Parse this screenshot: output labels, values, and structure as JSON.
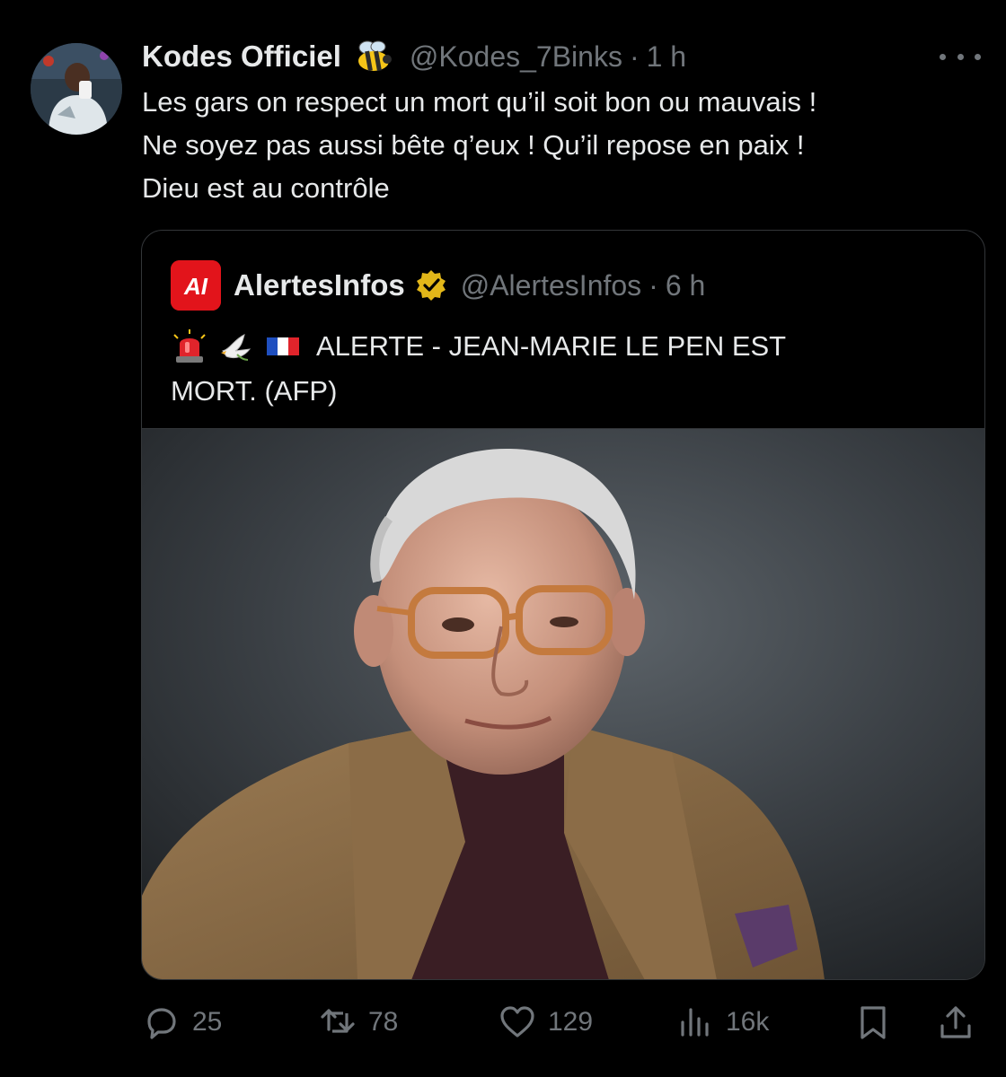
{
  "tweet": {
    "author_name": "Kodes Officiel",
    "author_handle": "@Kodes_7Binks",
    "separator": "·",
    "time": "1 h",
    "name_emoji": "bee",
    "text_lines": [
      "Les gars on respect un mort qu’il soit bon ou mauvais !",
      "Ne soyez pas aussi bête q’eux ! Qu’il repose en paix !",
      "Dieu est au contrôle"
    ]
  },
  "quote": {
    "author_name": "AlertesInfos",
    "author_handle": "@AlertesInfos",
    "separator": "·",
    "time": "6 h",
    "logo_text": "AI",
    "verified": true,
    "text_emojis": [
      "rotating-light",
      "dove",
      "flag-france"
    ],
    "text_line1": "ALERTE - JEAN-MARIE LE PEN EST",
    "text_line2": "MORT. (AFP)",
    "photo": "portrait of elderly man with glasses and tweed jacket on dark background"
  },
  "actions": {
    "replies": "25",
    "reposts": "78",
    "likes": "129",
    "views": "16k"
  },
  "colors": {
    "background": "#000000",
    "text": "#e7e9ea",
    "muted": "#71767b",
    "border": "#333639",
    "brand_red": "#e2141b",
    "verified_gold": "#e2b719"
  }
}
